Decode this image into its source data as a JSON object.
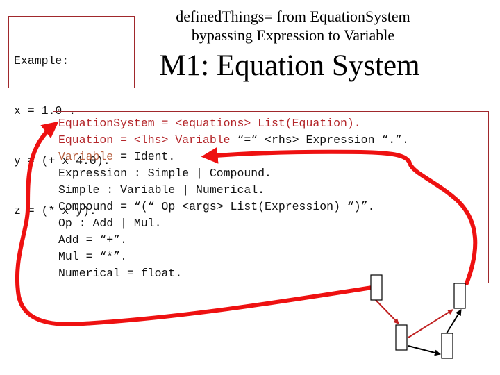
{
  "example": {
    "lines": [
      "Example:",
      "x = 1.0 .",
      "y = (+ x 4.0).",
      "z = (* x y)."
    ]
  },
  "header": {
    "subtitle_line1": "definedThings= from EquationSystem",
    "subtitle_line2": "bypassing Expression to Variable",
    "title": "M1: Equation System"
  },
  "grammar": {
    "lines": [
      {
        "parts": [
          {
            "text": "EquationSystem = <equations> List(Equation).",
            "style": "red"
          }
        ]
      },
      {
        "parts": [
          {
            "text": "Equation = <lhs> Variable",
            "style": "red"
          },
          {
            "text": " “=“ <rhs> Expression “.”.",
            "style": "plain"
          }
        ]
      },
      {
        "parts": [
          {
            "text": "Variable",
            "style": "brown"
          },
          {
            "text": " = Ident.",
            "style": "plain"
          }
        ]
      },
      {
        "parts": [
          {
            "text": "Expression : Simple | Compound.",
            "style": "plain"
          }
        ]
      },
      {
        "parts": [
          {
            "text": "Simple : Variable | Numerical.",
            "style": "plain"
          }
        ]
      },
      {
        "parts": [
          {
            "text": "Compound = “(“ Op <args> List(Expression) “)”.",
            "style": "plain"
          }
        ]
      },
      {
        "parts": [
          {
            "text": "Op : Add | Mul.",
            "style": "plain"
          }
        ]
      },
      {
        "parts": [
          {
            "text": "Add = “+”.",
            "style": "plain"
          }
        ]
      },
      {
        "parts": [
          {
            "text": "Mul = “*”.",
            "style": "plain"
          }
        ]
      },
      {
        "parts": [
          {
            "text": "Numerical = float.",
            "style": "plain"
          }
        ]
      }
    ]
  },
  "tree": {
    "nodes": [
      "equation-system-node",
      "equation-node",
      "variable-node",
      "expression-node"
    ],
    "edges": [
      {
        "from": "equation-system-node",
        "to": "equation-node",
        "color": "#c02020"
      },
      {
        "from": "equation-node",
        "to": "variable-node",
        "color": "#c02020"
      },
      {
        "from": "equation-node",
        "to": "expression-node",
        "color": "#000000"
      },
      {
        "from": "expression-node",
        "to": "variable-node",
        "color": "#000000"
      }
    ]
  },
  "colors": {
    "highlight_arrow": "#ee1111",
    "box_border": "#a0282c",
    "grammar_red": "#b4262a",
    "grammar_brown": "#b86444"
  }
}
